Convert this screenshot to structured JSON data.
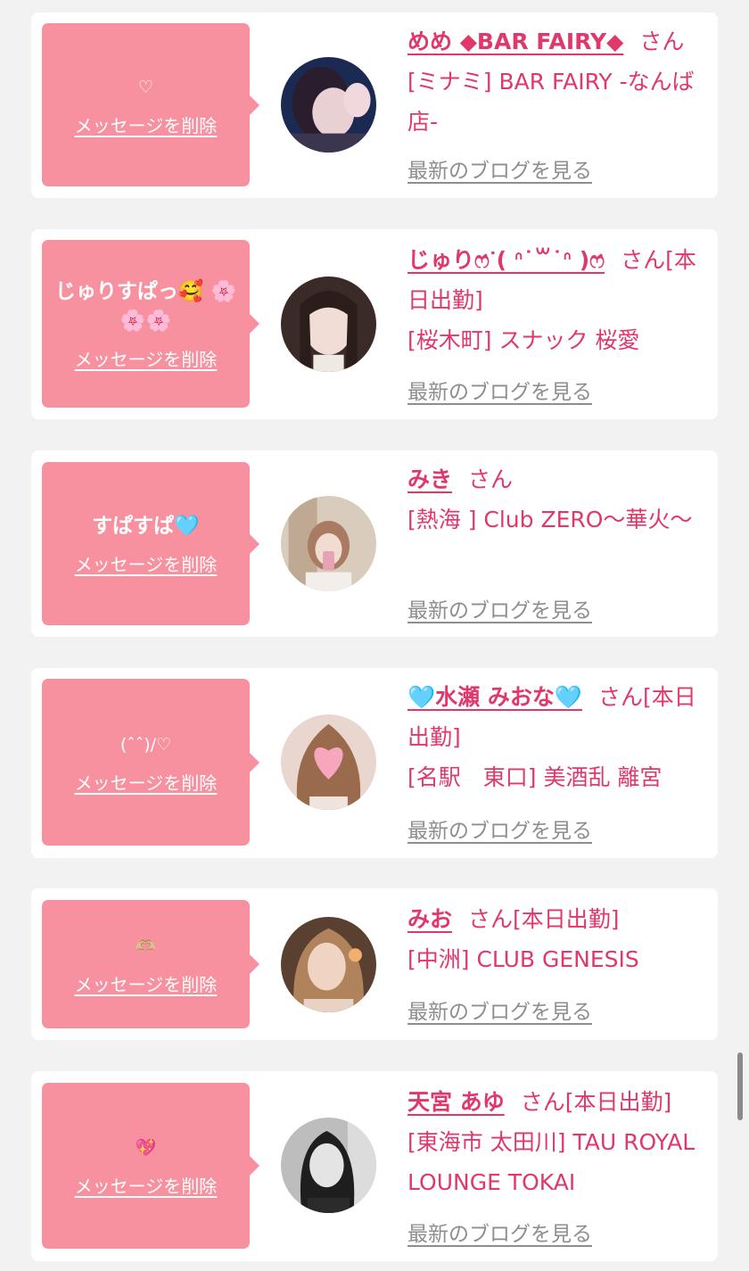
{
  "colors": {
    "page_bg": "#f2f2f2",
    "card_bg": "#ffffff",
    "bubble_pink": "#f8919f",
    "accent_text": "#e0386a",
    "link_gray": "#8e8e8e"
  },
  "delete_label": "メッセージを削除",
  "blog_link_label": "最新のブログを見る",
  "honorific": "さん",
  "entries": [
    {
      "message": "♡",
      "name": "めめ ◆BAR FAIRY◆",
      "suffix": "",
      "shop": "[ミナミ] BAR FAIRY -なんば店-",
      "avatar_icon": "profile-photo-icon"
    },
    {
      "message": "じゅりすぱっ🥰 🌸🌸🌸",
      "name": "じゅりෆ̇ᐝ( ᐢ˙꒳˙ᐢ )ෆ̇",
      "suffix": "[本日出勤]",
      "shop": "[桜木町] スナック 桜愛",
      "avatar_icon": "profile-photo-icon"
    },
    {
      "message": "すぱすぱ🩵",
      "name": "みき",
      "suffix": "",
      "shop": "[熱海 ] Club ZERO〜華火〜",
      "avatar_icon": "profile-photo-icon"
    },
    {
      "message": "(ˆˆ)/♡",
      "name": "🩵水瀬 みおな🩵",
      "suffix": "[本日出勤]",
      "shop": "[名駅　東口] 美酒乱 離宮",
      "avatar_icon": "profile-photo-icon"
    },
    {
      "message": "🫶🏼",
      "name": "みお",
      "suffix": "[本日出勤]",
      "shop": "[中洲] CLUB GENESIS",
      "avatar_icon": "profile-photo-icon"
    },
    {
      "message": "💖",
      "name": "天宮 あゆ",
      "suffix": "[本日出勤]",
      "shop": "[東海市 太田川] TAU ROYAL LOUNGE TOKAI",
      "avatar_icon": "profile-photo-icon"
    }
  ]
}
